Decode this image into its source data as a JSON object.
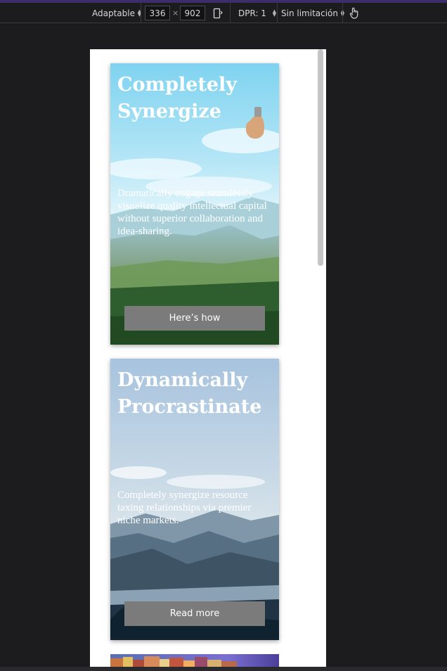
{
  "toolbar": {
    "device_mode": "Adaptable",
    "width": "336",
    "times": "×",
    "height": "902",
    "dpr_label": "DPR: 1",
    "throttling": "Sin limitación"
  },
  "cards": [
    {
      "title": "Completely Synergize",
      "text": "Dramatically engage seamlessly visualize quality intellectual capital without superior collaboration and idea-sharing.",
      "button": "Here’s how"
    },
    {
      "title": "Dynamically Procrastinate",
      "text": "Completely synergize resource taxing relationships via premier niche markets.",
      "button": "Read more"
    }
  ],
  "colors": {
    "toolbar_bg": "#1c1c1f",
    "accent": "#3d2e6b",
    "button_bg": "#7b7b7b",
    "page_bg": "#ffffff"
  }
}
